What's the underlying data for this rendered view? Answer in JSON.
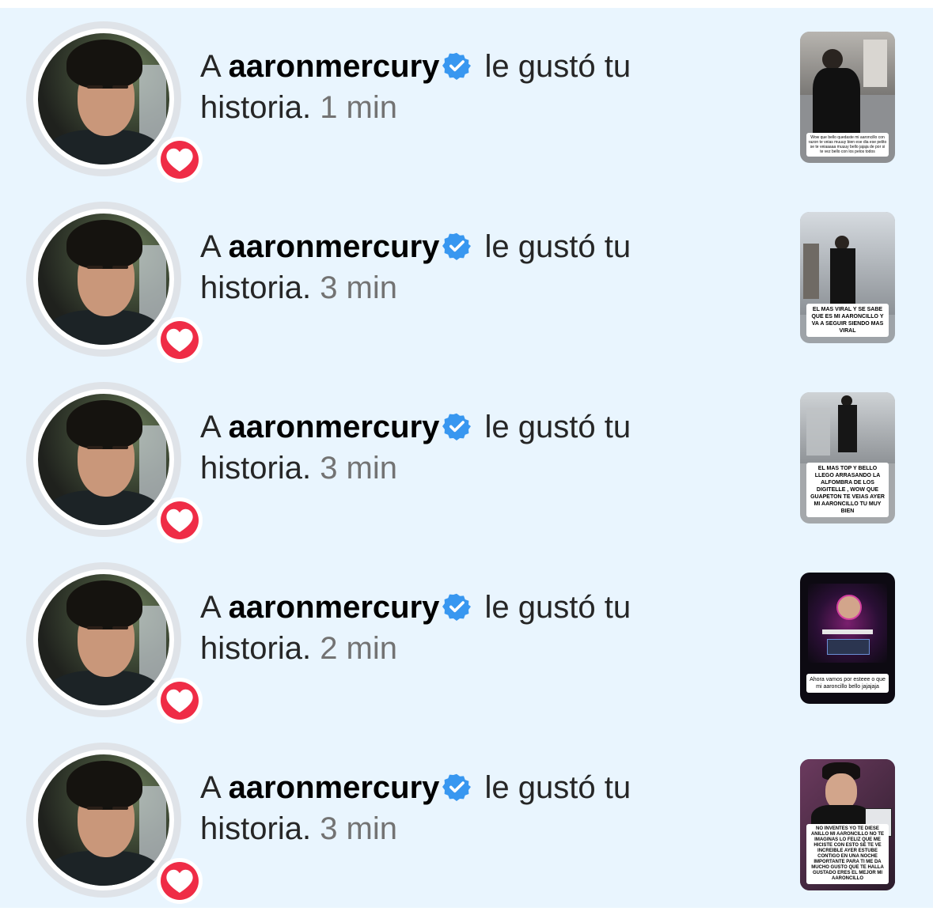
{
  "notifications": [
    {
      "prefix": "A",
      "username": "aaronmercury",
      "action": "le gustó tu",
      "object": "historia.",
      "time": "1 min",
      "verified": true,
      "thumb_caption": "Wow que bello quedaste mi aaroncillo con razon te veias muuuy bien ese dia ese pelito se te veiaaaaa muuuy bello jajaja de por si te vez bello con los pelos todos",
      "thumb_style": "light"
    },
    {
      "prefix": "A",
      "username": "aaronmercury",
      "action": "le gustó tu",
      "object": "historia.",
      "time": "3 min",
      "verified": true,
      "thumb_caption": "EL MAS VIRAL Y SE SABE QUE ES MI AARONCILLO Y VA A SEGUIR SIENDO MAS VIRAL",
      "thumb_style": "light"
    },
    {
      "prefix": "A",
      "username": "aaronmercury",
      "action": "le gustó tu",
      "object": "historia.",
      "time": "3 min",
      "verified": true,
      "thumb_caption": "EL MAS TOP Y BELLO LLEGO ARRASANDO LA ALFOMBRA DE LOS DIGITELLE , WOW QUE GUAPETON TE VEIAS AYER MI AARONCILLO TU MUY BIEN",
      "thumb_style": "light"
    },
    {
      "prefix": "A",
      "username": "aaronmercury",
      "action": "le gustó tu",
      "object": "historia.",
      "time": "2 min",
      "verified": true,
      "thumb_caption": "Ahora vamos por esteee o que mi aaroncillo bello jajajaja",
      "thumb_style": "dark"
    },
    {
      "prefix": "A",
      "username": "aaronmercury",
      "action": "le gustó tu",
      "object": "historia.",
      "time": "3 min",
      "verified": true,
      "thumb_caption": "NO INVENTES YO TE DIESE ANILLO MI AARONCILLO NO TE IMAGINAS LO FELIZ QUE ME HICISTE CON ESTO SE TE VE INCREIBLE AYER ESTUBE CONTIGO EN UNA NOCHE IMPORTANTE PARA TI ME DA MUCHO GUSTO QUE TE HALLA GUSTADO ERES EL MEJOR MI AARONCILLO",
      "thumb_style": "purple"
    }
  ],
  "colors": {
    "background": "#e9f5fe",
    "heart_badge": "#ef2c46",
    "verified_badge": "#3897f0",
    "timestamp": "#737373"
  },
  "icons": {
    "badge": "heart-icon",
    "verified": "verified-badge-icon"
  }
}
